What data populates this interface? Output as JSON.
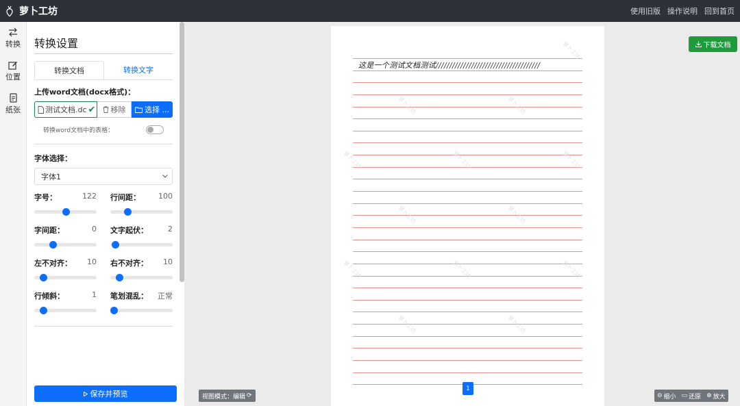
{
  "app": {
    "title": "萝卜工坊"
  },
  "top_links": [
    "使用旧版",
    "操作说明",
    "回到首页"
  ],
  "rail": [
    {
      "label": "转换",
      "icon": "swap-arrows-icon"
    },
    {
      "label": "位置",
      "icon": "edit-icon"
    },
    {
      "label": "纸张",
      "icon": "paper-icon"
    }
  ],
  "panel": {
    "title": "转换设置",
    "tabs": [
      "转换文档",
      "转换文字"
    ],
    "upload_label": "上传word文档(docx格式)：",
    "file_name": "测试文档.dc",
    "remove_label": "移除",
    "choose_label": "选择 ...",
    "table_toggle_label": "转换word文档中的表格：",
    "table_toggle_on": false,
    "font_label": "字体选择：",
    "font_value": "字体1",
    "params": [
      {
        "name": "字号：",
        "value": "122",
        "level": 0.5
      },
      {
        "name": "行间距：",
        "value": "100",
        "level": 0.28
      },
      {
        "name": "字间距：",
        "value": "0",
        "level": 0.3
      },
      {
        "name": "文字起伏：",
        "value": "2",
        "level": 0.08
      },
      {
        "name": "左不对齐：",
        "value": "10",
        "level": 0.14
      },
      {
        "name": "右不对齐：",
        "value": "10",
        "level": 0.14
      },
      {
        "name": "行倾斜：",
        "value": "1",
        "level": 0.14
      },
      {
        "name": "笔划混乱：",
        "value": "正常",
        "level": 0.05
      }
    ],
    "save_label": "保存并预览"
  },
  "preview": {
    "handwriting": "这是一个测试文档测试//////////////////////////////////////",
    "page_number": "1",
    "download_label": "下载文档",
    "view_mode_label": "视图模式：编辑",
    "zoom": [
      "缩小",
      "还原",
      "放大"
    ]
  },
  "colors": {
    "primary": "#0d6efd",
    "success": "#1e9c3c",
    "topbar": "#2d3138",
    "line": "#f08d8d"
  }
}
